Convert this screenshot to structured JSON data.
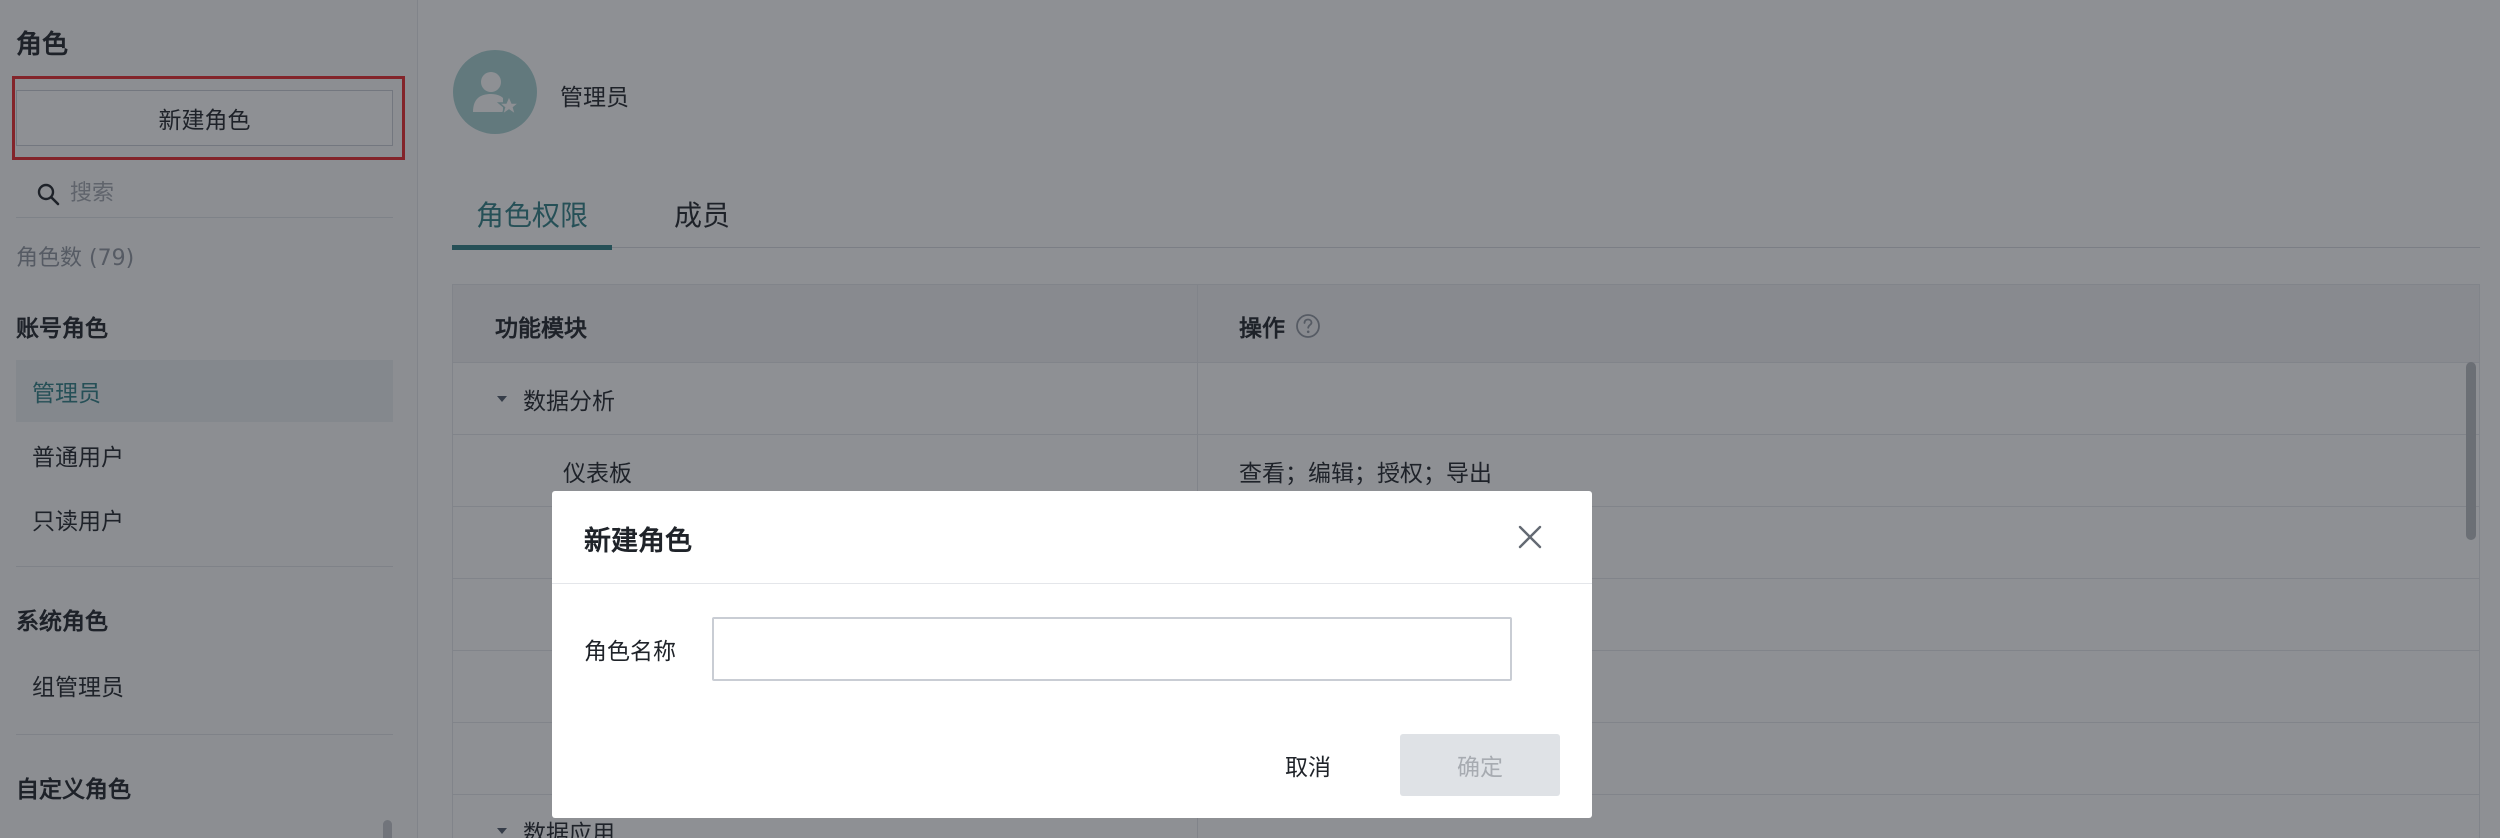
{
  "sidebar": {
    "title": "角色",
    "new_role_label": "新建角色",
    "search_placeholder": "搜索",
    "role_count": "角色数 (79)",
    "groups": [
      {
        "title": "账号角色",
        "items": [
          "管理员",
          "普通用户",
          "只读用户"
        ]
      },
      {
        "title": "系统角色",
        "items": [
          "组管理员"
        ]
      },
      {
        "title": "自定义角色",
        "items": []
      }
    ],
    "active_item": "管理员"
  },
  "main": {
    "role_name": "管理员",
    "tabs": [
      {
        "label": "角色权限",
        "active": true
      },
      {
        "label": "成员",
        "active": false
      }
    ],
    "table": {
      "headers": {
        "module": "功能模块",
        "operations": "操作"
      },
      "rows": [
        {
          "module": "数据分析",
          "operations": "",
          "expandable": true
        },
        {
          "module": "仪表板",
          "operations": "查看；编辑；授权；导出",
          "expandable": false
        },
        {
          "module": "",
          "operations": "",
          "expandable": false
        },
        {
          "module": "",
          "operations": "",
          "expandable": false
        },
        {
          "module": "",
          "operations": "",
          "expandable": false
        },
        {
          "module": "",
          "operations": "",
          "expandable": false
        },
        {
          "module": "数据应用",
          "operations": "",
          "expandable": true
        }
      ]
    }
  },
  "modal": {
    "title": "新建角色",
    "field_label": "角色名称",
    "field_value": "",
    "cancel_label": "取消",
    "ok_label": "确定",
    "ok_enabled": false
  },
  "icons": {
    "search": "search-icon",
    "help": "question-circle-icon",
    "close": "close-icon",
    "caret": "caret-down-icon",
    "avatar": "user-star-icon"
  },
  "colors": {
    "accent": "#2f7e84",
    "highlight": "#e8262b",
    "avatar_bg": "#a7d0d1"
  }
}
